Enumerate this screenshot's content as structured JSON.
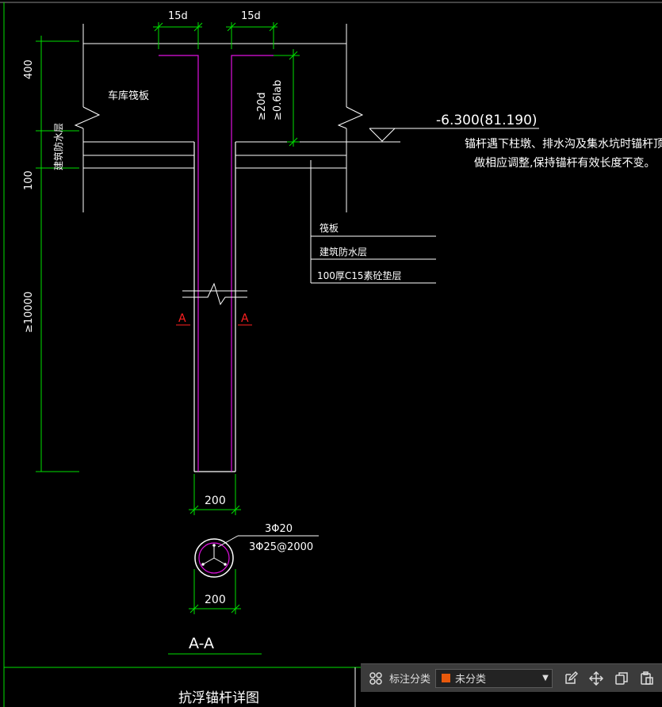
{
  "colors": {
    "background": "#000000",
    "white": "#ffffff",
    "green": "#00e000",
    "magenta": "#e010e0",
    "red": "#ff2020",
    "swatch": "#e8590c"
  },
  "drawing": {
    "dim_15d_left": "15d",
    "dim_15d_right": "15d",
    "dim_400": "400",
    "dim_100": "100",
    "dim_10000": "≥10000",
    "dim_20d": "≥20d",
    "dim_06lab": "≥0.6lab",
    "garage_slab_label": "车库筏板",
    "waterproof_vertical_label": "建筑防水层",
    "elevation": "-6.300(81.190)",
    "note_line1": "锚杆遇下柱墩、排水沟及集水坑时锚杆顶标高",
    "note_line2": "做相应调整,保持锚杆有效长度不变。",
    "legend_raft": "筏板",
    "legend_waterproof": "建筑防水层",
    "legend_cushion": "100厚C15素砼垫层",
    "section_mark_left": "A",
    "section_mark_right": "A",
    "dim_200_top": "200",
    "dim_200_bottom": "200",
    "rebar_main": "3Φ20",
    "rebar_stirrup": "3Φ25@2000",
    "section_title": "A-A",
    "detail_title": "抗浮锚杆详图"
  },
  "toolbar": {
    "grid_icon": "grid-icon",
    "label": "标注分类",
    "select_value": "未分类",
    "edit_icon": "edit-icon",
    "move_icon": "move-icon",
    "copy_icon": "copy-icon",
    "paste_icon": "paste-icon"
  }
}
